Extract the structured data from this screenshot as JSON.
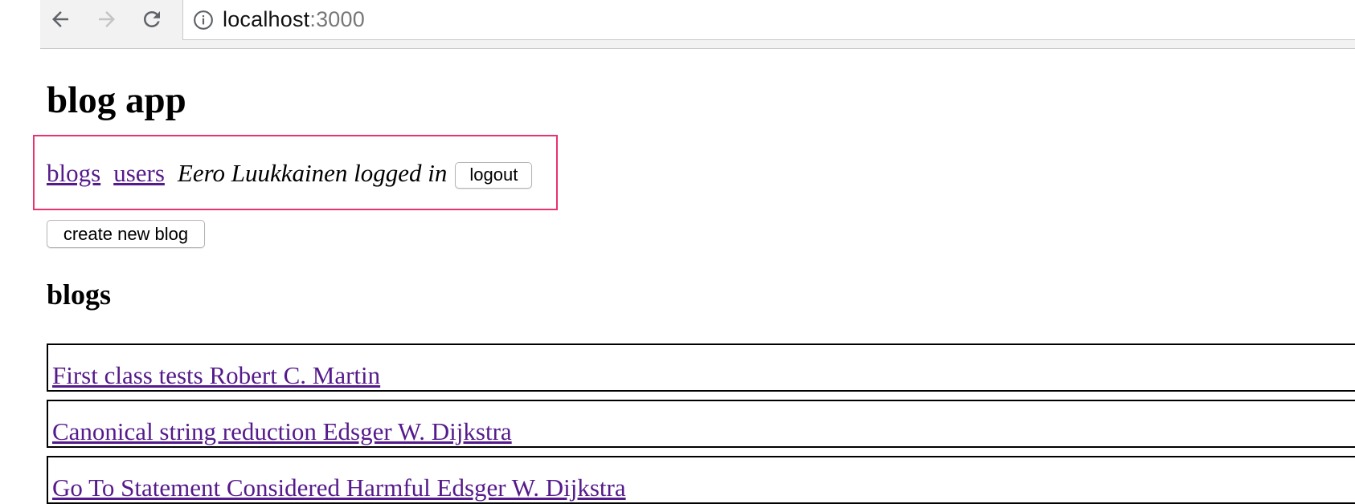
{
  "browser": {
    "url_host": "localhost",
    "url_port": ":3000"
  },
  "page": {
    "title": "blog app",
    "nav": {
      "blogs_link": "blogs",
      "users_link": "users",
      "logged_in_text": "Eero Luukkainen logged in",
      "logout_label": "logout"
    },
    "create_button_label": "create new blog",
    "blogs_heading": "blogs",
    "blogs": [
      {
        "label": "First class tests Robert C. Martin"
      },
      {
        "label": "Canonical string reduction Edsger W. Dijkstra"
      },
      {
        "label": "Go To Statement Considered Harmful Edsger W. Dijkstra"
      }
    ]
  },
  "colors": {
    "highlight_border": "#e8336e",
    "link": "#551a8b"
  },
  "icons": [
    "back-arrow-icon",
    "forward-arrow-icon",
    "reload-icon",
    "info-icon"
  ]
}
